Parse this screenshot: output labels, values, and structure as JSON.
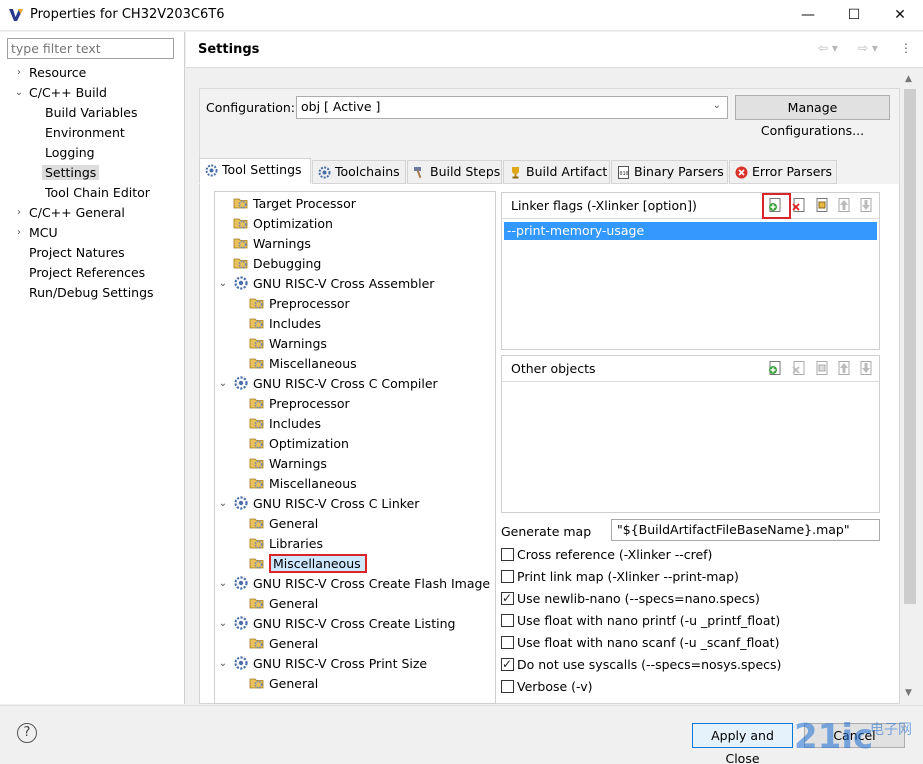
{
  "window": {
    "title": "Properties for CH32V203C6T6",
    "minimize": "—",
    "maximize": "☐",
    "close": "✕"
  },
  "filter": {
    "placeholder": "type filter text"
  },
  "nav": {
    "items": [
      {
        "label": "Resource",
        "arrow": "›"
      },
      {
        "label": "C/C++ Build",
        "arrow": "⌄"
      },
      {
        "label": "Build Variables"
      },
      {
        "label": "Environment"
      },
      {
        "label": "Logging"
      },
      {
        "label": "Settings"
      },
      {
        "label": "Tool Chain Editor"
      },
      {
        "label": "C/C++ General",
        "arrow": "›"
      },
      {
        "label": "MCU",
        "arrow": "›"
      },
      {
        "label": "Project Natures"
      },
      {
        "label": "Project References"
      },
      {
        "label": "Run/Debug Settings"
      }
    ]
  },
  "header": {
    "title": "Settings",
    "back": "⇦ ▾",
    "forward": "⇨ ▾",
    "menu": "⋮"
  },
  "configuration": {
    "label": "Configuration:",
    "value": "obj  [ Active ]",
    "caret": "⌄",
    "manage_label": "Manage Configurations..."
  },
  "tabs": [
    {
      "label": "Tool Settings"
    },
    {
      "label": "Toolchains"
    },
    {
      "label": "Build Steps"
    },
    {
      "label": "Build Artifact"
    },
    {
      "label": "Binary Parsers"
    },
    {
      "label": "Error Parsers"
    }
  ],
  "tree": {
    "items": [
      {
        "label": "Target Processor"
      },
      {
        "label": "Optimization"
      },
      {
        "label": "Warnings"
      },
      {
        "label": "Debugging"
      },
      {
        "label": "GNU RISC-V Cross Assembler",
        "exp": "⌄"
      },
      {
        "label": "Preprocessor"
      },
      {
        "label": "Includes"
      },
      {
        "label": "Warnings"
      },
      {
        "label": "Miscellaneous"
      },
      {
        "label": "GNU RISC-V Cross C Compiler",
        "exp": "⌄"
      },
      {
        "label": "Preprocessor"
      },
      {
        "label": "Includes"
      },
      {
        "label": "Optimization"
      },
      {
        "label": "Warnings"
      },
      {
        "label": "Miscellaneous"
      },
      {
        "label": "GNU RISC-V Cross C Linker",
        "exp": "⌄"
      },
      {
        "label": "General"
      },
      {
        "label": "Libraries"
      },
      {
        "label": "Miscellaneous"
      },
      {
        "label": "GNU RISC-V Cross Create Flash Image",
        "exp": "⌄"
      },
      {
        "label": "General"
      },
      {
        "label": "GNU RISC-V Cross Create Listing",
        "exp": "⌄"
      },
      {
        "label": "General"
      },
      {
        "label": "GNU RISC-V Cross Print Size",
        "exp": "⌄"
      },
      {
        "label": "General"
      }
    ]
  },
  "linker_flags": {
    "title": "Linker flags (-Xlinker [option])",
    "items": [
      "--print-memory-usage"
    ]
  },
  "other_objects": {
    "title": "Other objects"
  },
  "generate_map": {
    "label": "Generate map",
    "value": "\"${BuildArtifactFileBaseName}.map\""
  },
  "options": [
    {
      "label": "Cross reference (-Xlinker --cref)",
      "checked": false
    },
    {
      "label": "Print link map (-Xlinker --print-map)",
      "checked": false
    },
    {
      "label": "Use newlib-nano (--specs=nano.specs)",
      "checked": true
    },
    {
      "label": "Use float with nano printf (-u _printf_float)",
      "checked": false
    },
    {
      "label": "Use float with nano scanf (-u _scanf_float)",
      "checked": false
    },
    {
      "label": "Do not use syscalls (--specs=nosys.specs)",
      "checked": true
    },
    {
      "label": "Verbose (-v)",
      "checked": false
    }
  ],
  "footer": {
    "help": "?",
    "apply_label": "Apply and Close",
    "cancel_label": "Cancel"
  },
  "watermark": {
    "text": "21ic",
    "cn": "电子网"
  },
  "colors": {
    "selection": "#3399ff",
    "highlight_border": "#d9252a",
    "accent": "#0078d7"
  }
}
